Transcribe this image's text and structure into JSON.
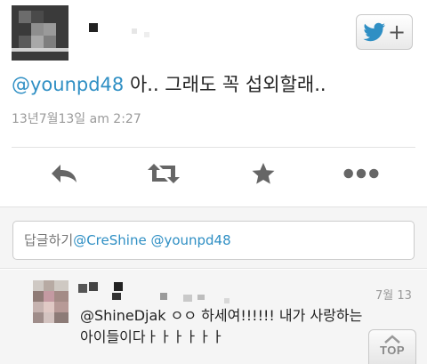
{
  "tweet": {
    "mention": "@younpd48",
    "text": " 아.. 그래도 꼭 섭외할래..",
    "timestamp": "13년7월13일 am 2:27"
  },
  "follow_button": {
    "plus": "+"
  },
  "actions": {
    "reply": "reply-icon",
    "retweet": "retweet-icon",
    "favorite": "star-icon",
    "more": "more-icon"
  },
  "reply_box": {
    "prefix": "답글하기",
    "mentions": "@CreShine @younpd48"
  },
  "reply_tweet": {
    "date": "7월 13",
    "line1": "@ShineDjak ㅇㅇ 하세여!!!!!! 내가 사랑하는",
    "line2": "아이들이다ㅏㅏㅏㅏㅏㅏ"
  },
  "top_button": {
    "label": "TOP"
  },
  "colors": {
    "link": "#2f8fc4",
    "twitter_blue": "#2f8fc4"
  }
}
